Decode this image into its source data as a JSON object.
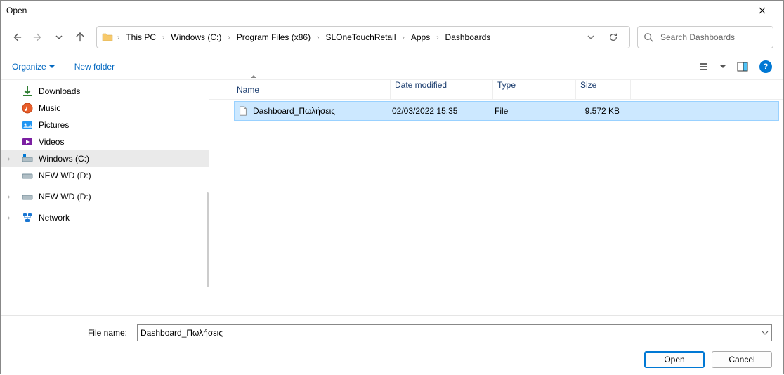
{
  "window": {
    "title": "Open"
  },
  "breadcrumbs": [
    "This PC",
    "Windows (C:)",
    "Program Files (x86)",
    "SLOneTouchRetail",
    "Apps",
    "Dashboards"
  ],
  "search": {
    "placeholder": "Search Dashboards"
  },
  "toolbar": {
    "organize": "Organize",
    "newfolder": "New folder"
  },
  "sidebar": {
    "items": [
      {
        "label": "Downloads",
        "icon": "download"
      },
      {
        "label": "Music",
        "icon": "music"
      },
      {
        "label": "Pictures",
        "icon": "pictures"
      },
      {
        "label": "Videos",
        "icon": "videos"
      },
      {
        "label": "Windows (C:)",
        "icon": "windrive",
        "selected": true
      },
      {
        "label": "NEW WD (D:)",
        "icon": "drive"
      }
    ],
    "second_group": [
      {
        "label": "NEW WD (D:)",
        "icon": "drive"
      }
    ],
    "network": {
      "label": "Network"
    }
  },
  "columns": {
    "name": "Name",
    "date": "Date modified",
    "type": "Type",
    "size": "Size"
  },
  "files": [
    {
      "name": "Dashboard_Πωλήσεις",
      "date": "02/03/2022 15:35",
      "type": "File",
      "size": "9.572 KB"
    }
  ],
  "footer": {
    "filename_label": "File name:",
    "filename_value": "Dashboard_Πωλήσεις",
    "open": "Open",
    "cancel": "Cancel"
  }
}
